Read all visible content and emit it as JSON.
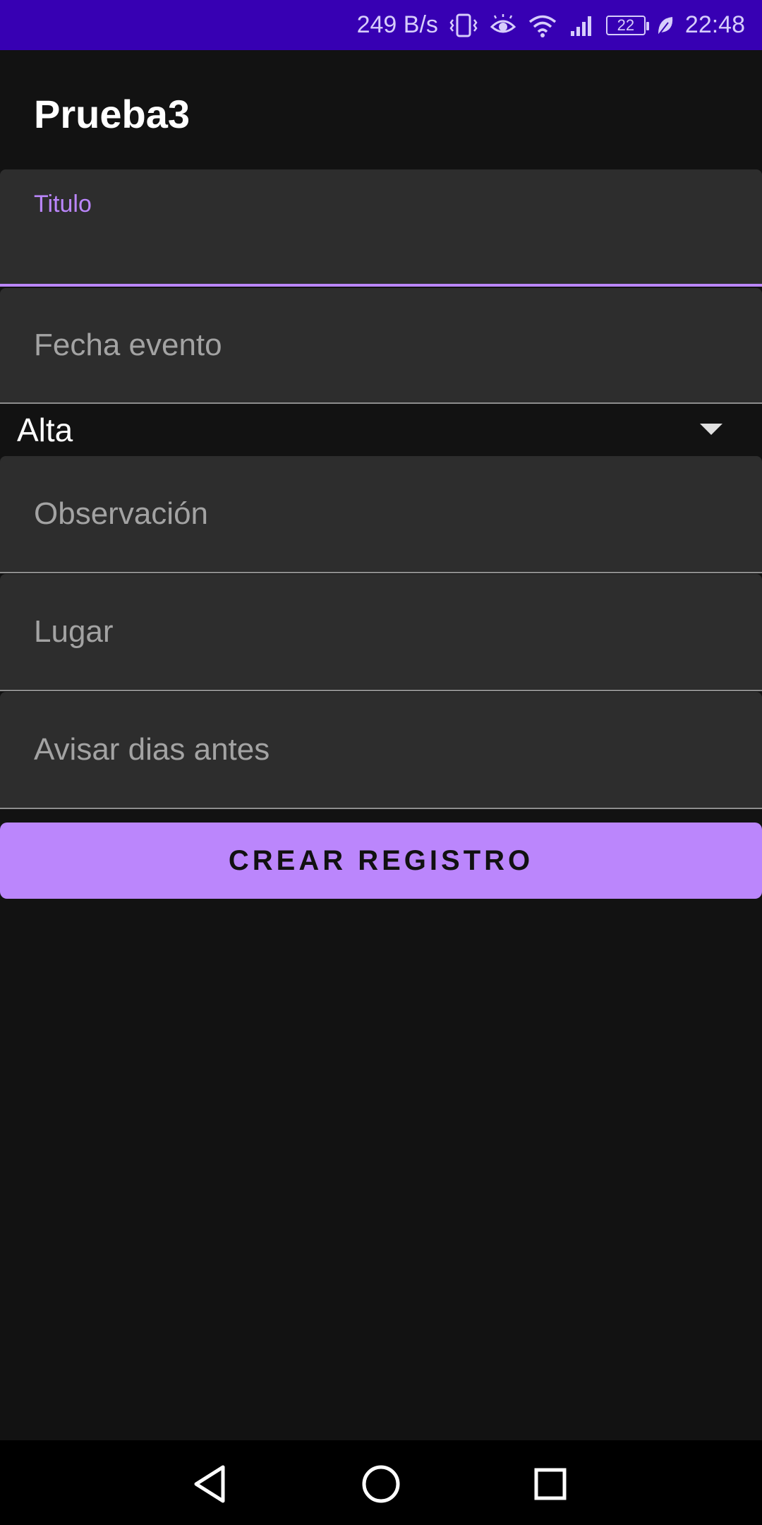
{
  "status_bar": {
    "network_speed": "249 B/s",
    "battery_level": "22",
    "time": "22:48",
    "icons": [
      "vibrate-icon",
      "eye-comfort-icon",
      "wifi-icon",
      "signal-icon",
      "battery-icon",
      "leaf-icon"
    ]
  },
  "app_bar": {
    "title": "Prueba3"
  },
  "form": {
    "titulo_label": "Titulo",
    "fecha_placeholder": "Fecha evento",
    "priority_selected": "Alta",
    "observacion_placeholder": "Observación",
    "lugar_placeholder": "Lugar",
    "avisar_placeholder": "Avisar dias antes",
    "submit_label": "CREAR REGISTRO"
  },
  "nav_bar": {
    "icons": [
      "back-icon",
      "home-icon",
      "recents-icon"
    ]
  },
  "colors": {
    "status_bar": "#3700B3",
    "accent": "#bb86fc",
    "background": "#121212",
    "field_background": "#2d2d2d"
  }
}
